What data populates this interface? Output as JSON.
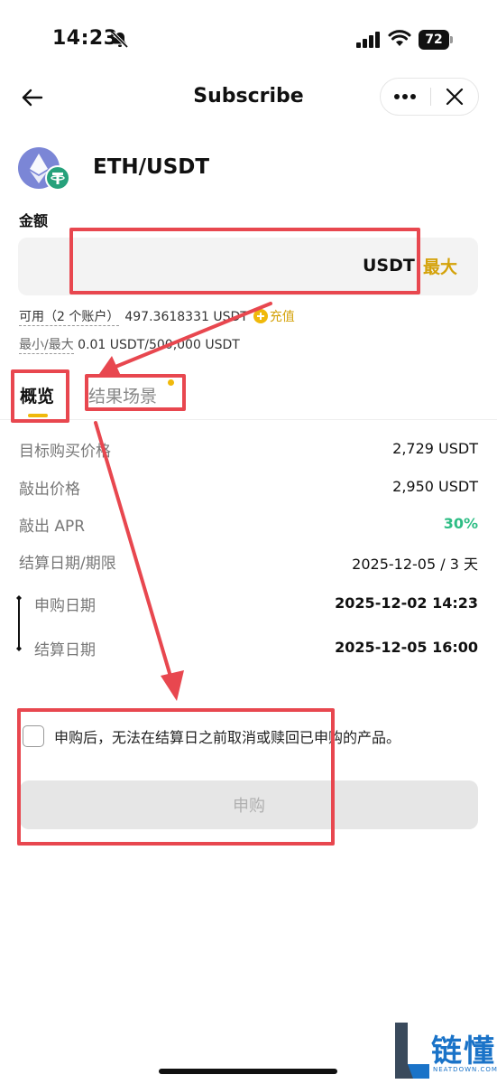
{
  "status_bar": {
    "time": "14:23",
    "battery": "72"
  },
  "header": {
    "title": "Subscribe"
  },
  "pair": {
    "name": "ETH/USDT"
  },
  "amount": {
    "label": "金额",
    "placeholder": "",
    "unit": "USDT",
    "max_label": "最大"
  },
  "available": {
    "label": "可用（2 个账户）",
    "value": "497.3618331 USDT",
    "deposit_label": "充值"
  },
  "limits": {
    "label": "最小/最大",
    "value": "0.01 USDT/500,000 USDT"
  },
  "tabs": [
    {
      "label": "概览",
      "active": true
    },
    {
      "label": "结果场景",
      "active": false
    }
  ],
  "details": [
    {
      "label": "目标购买价格",
      "value": "2,729 USDT"
    },
    {
      "label": "敲出价格",
      "value": "2,950 USDT"
    },
    {
      "label": "敲出 APR",
      "value": "30%"
    },
    {
      "label": "结算日期/期限",
      "value": "2025-12-05 / 3 天"
    }
  ],
  "timeline": [
    {
      "label": "申购日期",
      "value": "2025-12-02 14:23"
    },
    {
      "label": "结算日期",
      "value": "2025-12-05 16:00"
    }
  ],
  "agreement": {
    "text": "申购后，无法在结算日之前取消或赎回已申购的产品。"
  },
  "action": {
    "subscribe_label": "申购"
  },
  "watermark": {
    "text": "链懂",
    "sub": "NEATDOWN.COM"
  },
  "colors": {
    "accent": "#f0b90b",
    "positive": "#2ebd85",
    "annotation": "#e8474f"
  }
}
